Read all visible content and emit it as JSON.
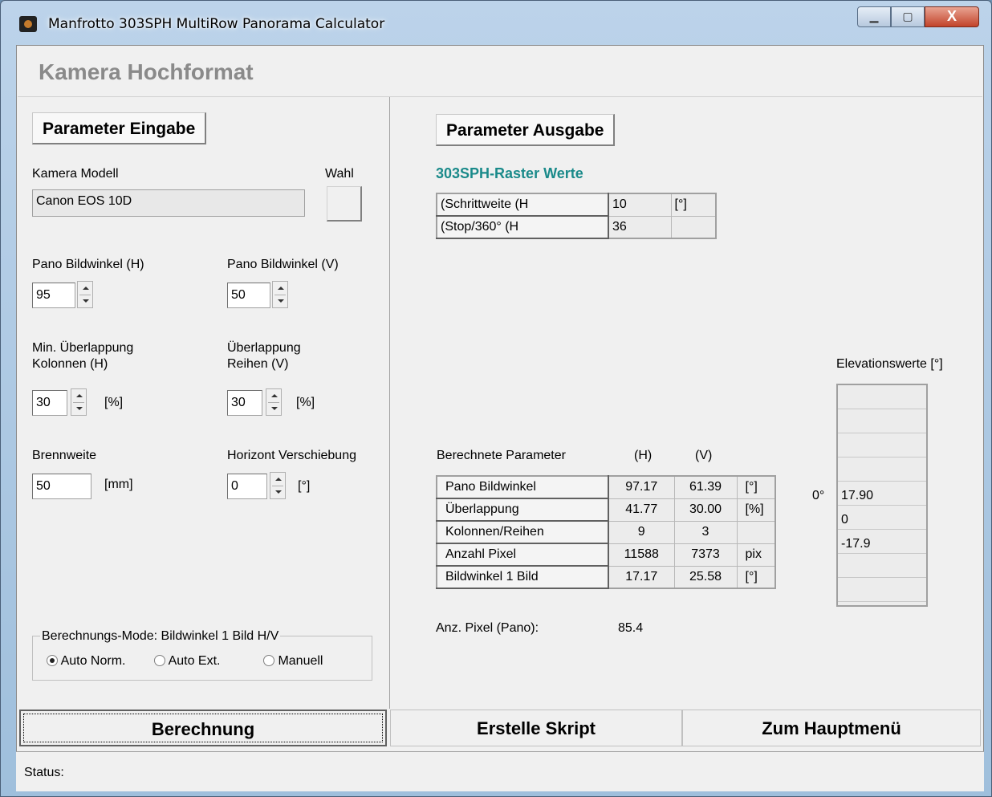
{
  "window": {
    "title": "Manfrotto  303SPH MultiRow Panorama Calculator",
    "buttons": {
      "minimize": "▁",
      "maximize": "▢",
      "close": "X"
    }
  },
  "page_title": "Kamera Hochformat",
  "input": {
    "section_button": "Parameter Eingabe",
    "camera_label": "Kamera Modell",
    "camera_value": "Canon EOS 10D",
    "choose_label": "Wahl",
    "pano_h_label": "Pano Bildwinkel (H)",
    "pano_h_value": "95",
    "pano_v_label": "Pano Bildwinkel (V)",
    "pano_v_value": "50",
    "overlap_cols_label1": "Min. Überlappung",
    "overlap_cols_label2": "Kolonnen (H)",
    "overlap_cols_value": "30",
    "overlap_cols_unit": "[%]",
    "overlap_rows_label1": "Überlappung",
    "overlap_rows_label2": "Reihen (V)",
    "overlap_rows_value": "30",
    "overlap_rows_unit": "[%]",
    "focal_label": "Brennweite",
    "focal_value": "50",
    "focal_unit": "[mm]",
    "horizon_label": "Horizont Verschiebung",
    "horizon_value": "0",
    "horizon_unit": "[°]",
    "mode_legend": "Berechnungs-Mode: Bildwinkel 1 Bild H/V",
    "mode_options": [
      "Auto Norm.",
      "Auto Ext.",
      "Manuell"
    ],
    "mode_selected": "Auto Norm."
  },
  "output": {
    "section_button": "Parameter Ausgabe",
    "raster_title": "303SPH-Raster Werte",
    "raster_rows": [
      {
        "label": "(Schrittweite (H",
        "value": "10",
        "unit": "[°]"
      },
      {
        "label": "(Stop/360° (H",
        "value": "36",
        "unit": ""
      }
    ],
    "calc_title": "Berechnete Parameter",
    "col_h": "(H)",
    "col_v": "(V)",
    "calc_rows": [
      {
        "label": "Pano Bildwinkel",
        "h": "97.17",
        "v": "61.39",
        "unit": "[°]"
      },
      {
        "label": "Überlappung",
        "h": "41.77",
        "v": "30.00",
        "unit": "[%]"
      },
      {
        "label": "Kolonnen/Reihen",
        "h": "9",
        "v": "3",
        "unit": ""
      },
      {
        "label": "Anzahl Pixel",
        "h": "11588",
        "v": "7373",
        "unit": "pix"
      },
      {
        "label": "Bildwinkel 1 Bild",
        "h": "17.17",
        "v": "25.58",
        "unit": "[°]"
      }
    ],
    "pixel_label": "Anz. Pixel (Pano):",
    "pixel_value": "85.4",
    "elevation_title": "Elevationswerte [°]",
    "zero_marker": "0°",
    "elevation_values": [
      "",
      "",
      "",
      "",
      "17.90",
      "0",
      "-17.9",
      "",
      "",
      ""
    ]
  },
  "buttons": {
    "berechnung": "Berechnung",
    "skript": "Erstelle Skript",
    "hauptmenu": "Zum Hauptmenü"
  },
  "status": {
    "label": "Status:"
  }
}
